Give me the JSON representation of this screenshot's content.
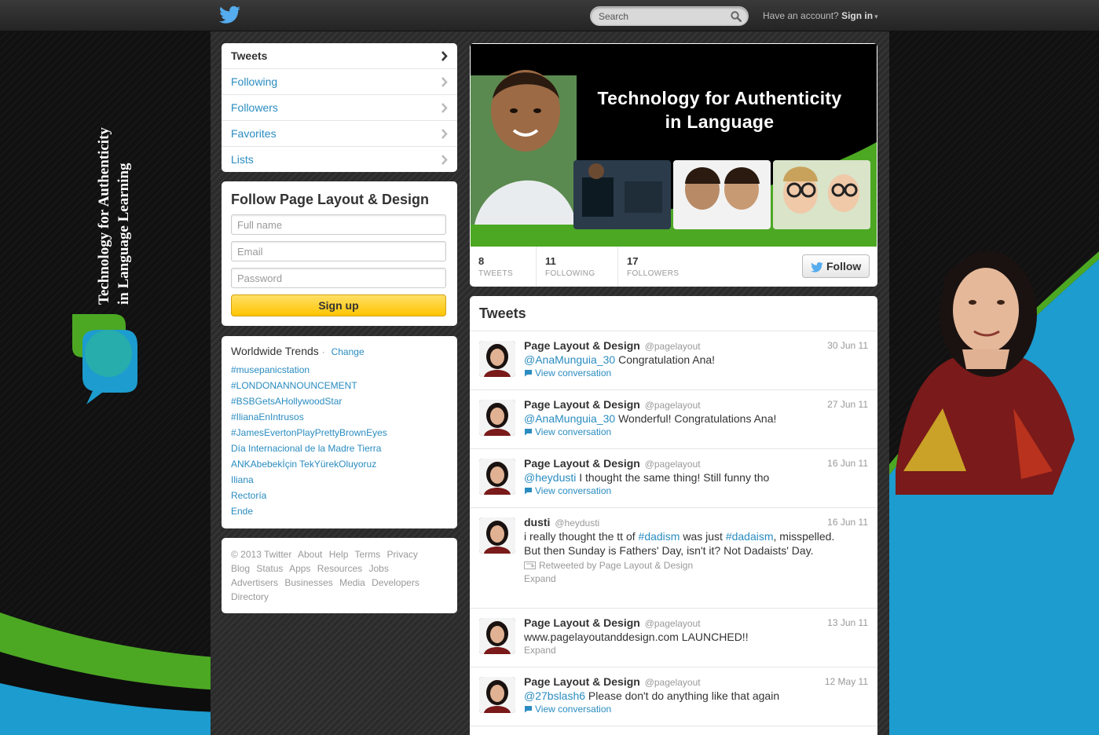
{
  "topbar": {
    "search": {
      "placeholder": "Search"
    },
    "account_prompt": "Have an account?",
    "signin_label": "Sign in",
    "caret": "▾"
  },
  "side_logo": {
    "line1": "Technology for Authenticity",
    "line2": "in Language Learning"
  },
  "nav": {
    "items": [
      {
        "label": "Tweets"
      },
      {
        "label": "Following"
      },
      {
        "label": "Followers"
      },
      {
        "label": "Favorites"
      },
      {
        "label": "Lists"
      }
    ]
  },
  "signup": {
    "title": "Follow Page Layout & Design",
    "fullname_placeholder": "Full name",
    "email_placeholder": "Email",
    "password_placeholder": "Password",
    "button_label": "Sign up"
  },
  "trends": {
    "title": "Worldwide Trends",
    "separator": "·",
    "change_label": "Change",
    "items": [
      "#musepanicstation",
      "#LONDONANNOUNCEMENT",
      "#BSBGetsAHollywoodStar",
      "#IlianaEnIntrusos",
      "#JamesEvertonPlayPrettyBrownEyes",
      "Día Internacional de la Madre Tierra",
      "ANKAbebekİçin TekYürekOluyoruz",
      "Iliana",
      "Rectoría",
      "Ende"
    ]
  },
  "footer": {
    "links": [
      "© 2013 Twitter",
      "About",
      "Help",
      "Terms",
      "Privacy",
      "Blog",
      "Status",
      "Apps",
      "Resources",
      "Jobs",
      "Advertisers",
      "Businesses",
      "Media",
      "Developers",
      "Directory"
    ]
  },
  "profile": {
    "header_title_line1": "Technology for Authenticity",
    "header_title_line2": "in Language",
    "stats": [
      {
        "num": "8",
        "label": "TWEETS"
      },
      {
        "num": "11",
        "label": "FOLLOWING"
      },
      {
        "num": "17",
        "label": "FOLLOWERS"
      }
    ],
    "follow_label": "Follow"
  },
  "tweets": {
    "heading": "Tweets",
    "items": [
      {
        "author": "Page Layout & Design",
        "handle": "@pagelayout",
        "time": "30 Jun 11",
        "mention": "@AnaMunguia_30",
        "text": " Congratulation Ana!",
        "meta": "View conversation"
      },
      {
        "author": "Page Layout & Design",
        "handle": "@pagelayout",
        "time": "27 Jun 11",
        "mention": "@AnaMunguia_30",
        "text": " Wonderful! Congratulations Ana!",
        "meta": "View conversation"
      },
      {
        "author": "Page Layout & Design",
        "handle": "@pagelayout",
        "time": "16 Jun 11",
        "mention": "@heydusti",
        "text": " I thought the same thing! Still funny tho",
        "meta": "View conversation"
      },
      {
        "author": "dusti",
        "handle": "@heydusti",
        "time": "16 Jun 11",
        "text_a": "i really thought the tt of ",
        "hashtag1": "#dadism",
        "text_b": " was just ",
        "hashtag2": "#dadaism",
        "text_c": ", misspelled. But then Sunday is Fathers' Day, isn't it? Not Dadaists' Day.",
        "retweeted_by": "Retweeted by Page Layout & Design",
        "meta": "Expand"
      },
      {
        "author": "Page Layout & Design",
        "handle": "@pagelayout",
        "time": "13 Jun 11",
        "text": "www.pagelayoutanddesign.com LAUNCHED!!",
        "meta": "Expand"
      },
      {
        "author": "Page Layout & Design",
        "handle": "@pagelayout",
        "time": "12 May 11",
        "mention": "@27bslash6",
        "text": " Please don't do anything like that again",
        "meta": "View conversation"
      }
    ]
  },
  "colors": {
    "link": "#2a8cc0",
    "signup_button": "#ffc400",
    "brand_blue": "#55acee",
    "bg_green": "#4ca823",
    "bg_blue": "#1c9ccf"
  }
}
